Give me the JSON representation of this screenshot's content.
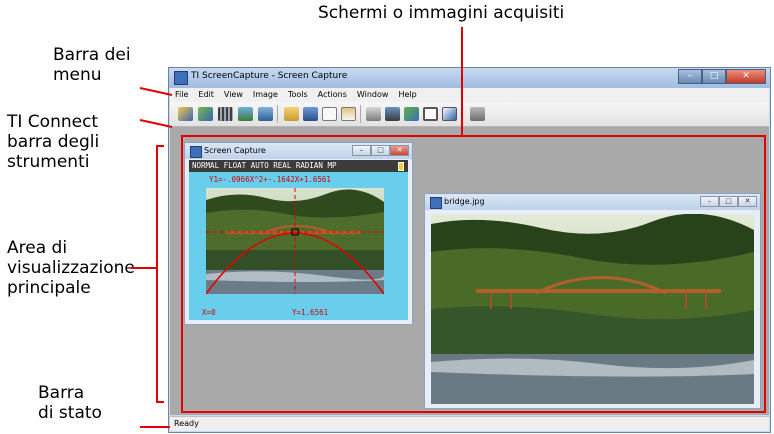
{
  "annotations": {
    "top_label": "Schermi o immagini acquisiti",
    "menu_bar_label": [
      "Barra dei",
      "menu"
    ],
    "toolbar_label": [
      "TI Connect",
      "barra degli",
      "strumenti"
    ],
    "display_area_label": [
      "Area di",
      "visualizzazione",
      "principale"
    ],
    "status_bar_label": [
      "Barra",
      "di stato"
    ]
  },
  "window": {
    "title": "TI ScreenCapture - Screen Capture",
    "controls": [
      "–",
      "□",
      "✕"
    ]
  },
  "menu": [
    "File",
    "Edit",
    "View",
    "Image",
    "Tools",
    "Actions",
    "Window",
    "Help"
  ],
  "toolbar_icons": [
    "capture-icon",
    "capture-multiple-icon",
    "grid-icon",
    "screen-icon",
    "folder-icon",
    "open-icon",
    "save-icon",
    "copy-icon",
    "paste-icon",
    "print-icon",
    "camera-icon",
    "send-icon",
    "border-icon",
    "edit-icon",
    "device-icon"
  ],
  "screen_capture": {
    "title": "Screen Capture",
    "header": "NORMAL FLOAT AUTO REAL RADIAN MP",
    "equation": "Y1=-.0966X^2+-.1642X+1.6561",
    "x_readout": "X=0",
    "y_readout": "Y=1.6561"
  },
  "bridge_window": {
    "title": "bridge.jpg"
  },
  "status": {
    "text": "Ready"
  },
  "colors": {
    "annotation_red": "#e00000",
    "calc_background": "#69cdec",
    "calc_text": "#d10000"
  }
}
